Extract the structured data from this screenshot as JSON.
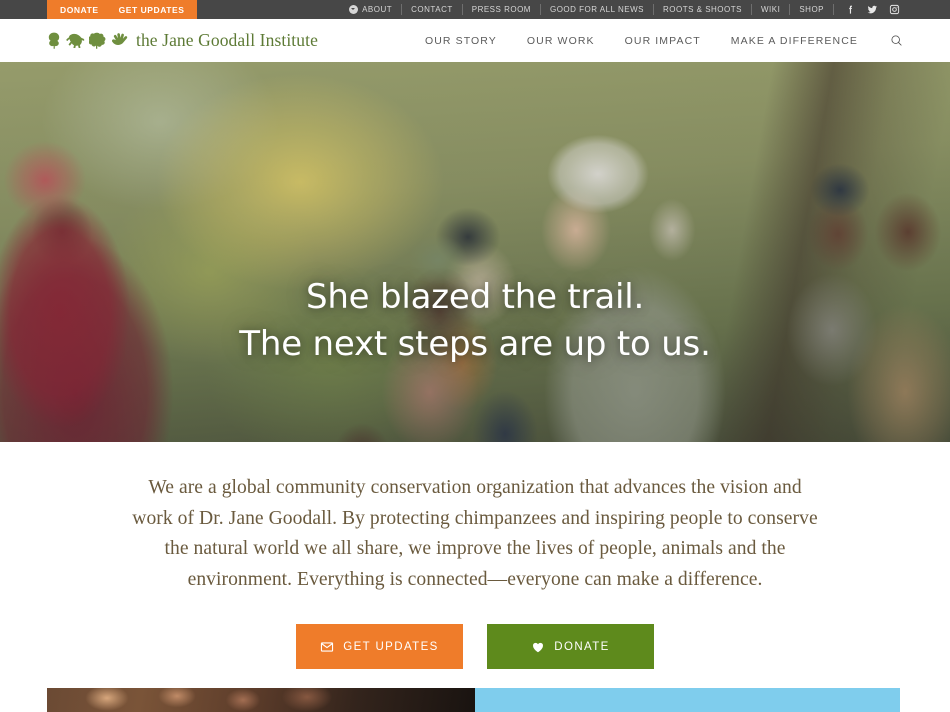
{
  "topbar": {
    "promo_tabs": [
      {
        "label": "DONATE"
      },
      {
        "label": "GET UPDATES"
      }
    ],
    "util_links": [
      {
        "label": "ABOUT",
        "icon": "chevron-down-circle-icon"
      },
      {
        "label": "CONTACT"
      },
      {
        "label": "PRESS ROOM"
      },
      {
        "label": "GOOD FOR ALL NEWS"
      },
      {
        "label": "ROOTS & SHOOTS"
      },
      {
        "label": "WIKI"
      },
      {
        "label": "SHOP"
      }
    ],
    "social": [
      {
        "name": "facebook-icon"
      },
      {
        "name": "twitter-icon"
      },
      {
        "name": "instagram-icon"
      }
    ],
    "background_color": "#474747",
    "promo_color": "#ef7c2a"
  },
  "header": {
    "logo_text": "the Jane Goodall Institute",
    "logo_color": "#5d7a35",
    "logo_icons": [
      {
        "name": "tree-icon"
      },
      {
        "name": "chimpanzee-icon"
      },
      {
        "name": "leaf-icon"
      },
      {
        "name": "hand-icon"
      }
    ],
    "nav": [
      {
        "label": "OUR STORY"
      },
      {
        "label": "OUR WORK"
      },
      {
        "label": "OUR IMPACT"
      },
      {
        "label": "MAKE A DIFFERENCE"
      }
    ],
    "search_icon": "search-icon"
  },
  "hero": {
    "headline_line1": "She blazed the trail.",
    "headline_line2": "The next steps are up to us.",
    "image_alt": "Dr. Jane Goodall smiling among a group of women and children outdoors"
  },
  "intro": {
    "paragraph": "We are a global community conservation organization that advances the vision and work of Dr. Jane Goodall. By protecting chimpanzees and inspiring people to conserve the natural world we all share, we improve the lives of people, animals and the environment. Everything is connected—everyone can make a difference.",
    "text_color": "#6a5a3e",
    "buttons": [
      {
        "label": "GET UPDATES",
        "icon": "envelope-icon",
        "color": "#ef7c2a"
      },
      {
        "label": "DONATE",
        "icon": "heart-icon",
        "color": "#5e8a1c"
      }
    ]
  },
  "bottom_strip": {
    "panel_color": "#7fcded"
  }
}
